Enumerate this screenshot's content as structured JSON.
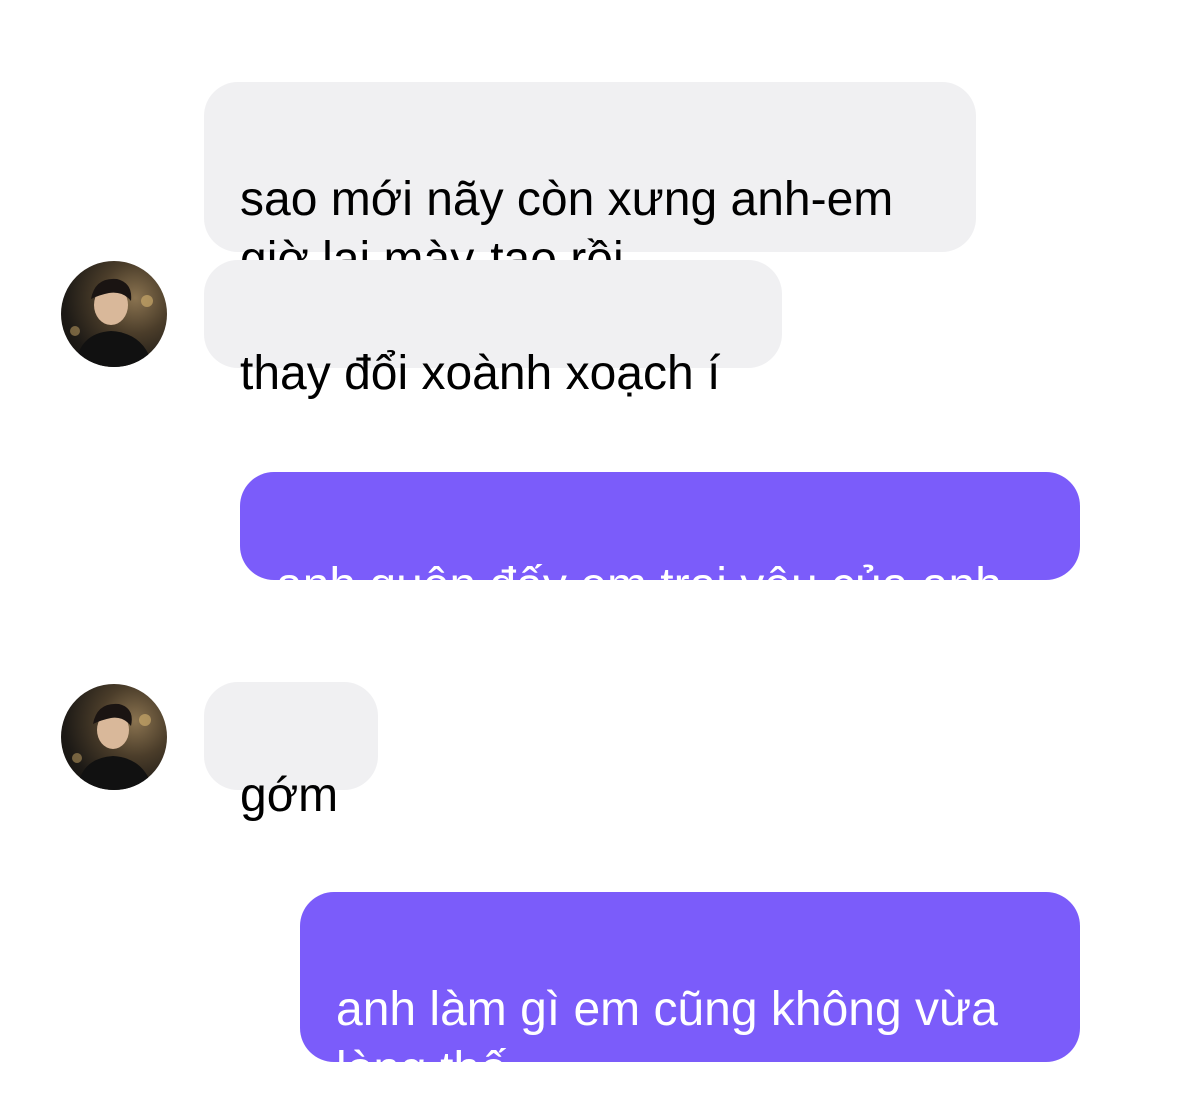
{
  "theme": {
    "incoming_bg": "#f0f0f2",
    "incoming_text": "#000000",
    "outgoing_bg": "#7b5cfa",
    "outgoing_text": "#ffffff"
  },
  "messages": [
    {
      "direction": "incoming",
      "text": "sao mới nãy còn xưng anh-em\ngiờ lại mày-tao rồi"
    },
    {
      "direction": "incoming",
      "text": "thay đổi xoành xoạch í",
      "avatar": "contact-avatar"
    },
    {
      "direction": "outgoing",
      "text": "anh quên đấy em trai yêu của anh"
    },
    {
      "direction": "incoming",
      "text": "gớm",
      "avatar": "contact-avatar"
    },
    {
      "direction": "outgoing",
      "text": "anh làm gì em cũng không vừa\nlòng thế"
    }
  ]
}
